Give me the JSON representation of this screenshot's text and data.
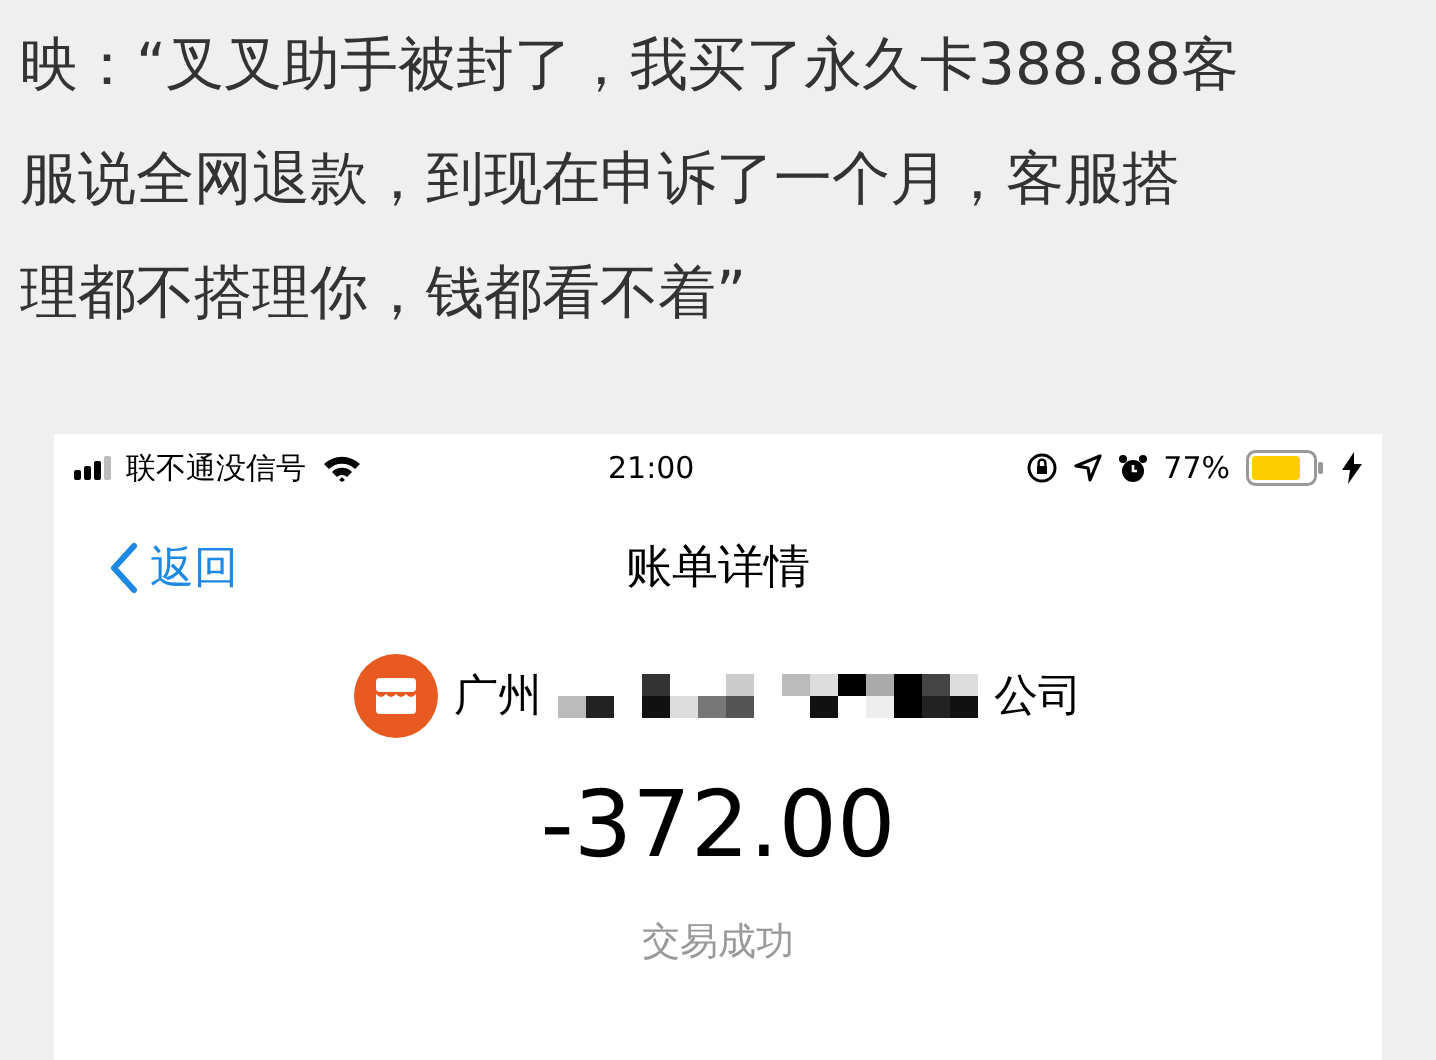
{
  "article": {
    "lines": [
      "映：“叉叉助手被封了，我买了永久卡388.88客",
      "服说全网退款，到现在申诉了一个月，客服搭",
      "理都不搭理你，钱都看不着”"
    ]
  },
  "phone": {
    "status_bar": {
      "carrier": "联不通没信号",
      "time": "21:00",
      "battery": "77%"
    },
    "nav": {
      "back": "返回",
      "title": "账单详情"
    },
    "bill": {
      "merchant_start": "广州",
      "merchant_end": "公司",
      "amount": "-372.00",
      "status": "交易成功"
    }
  }
}
